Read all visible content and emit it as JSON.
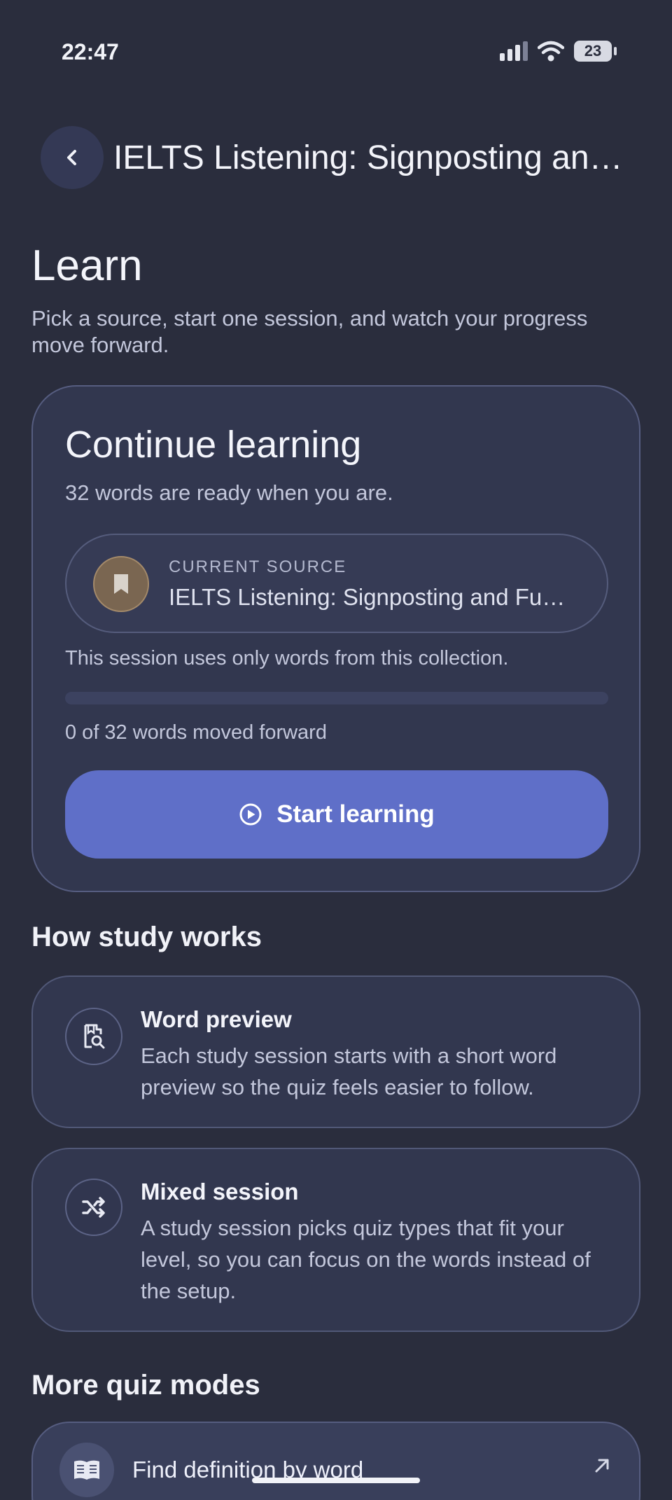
{
  "status": {
    "time": "22:47",
    "battery": "23"
  },
  "header": {
    "title": "IELTS Listening: Signposting an…"
  },
  "page": {
    "title": "Learn",
    "subtitle": "Pick a source, start one session, and watch your progress move forward."
  },
  "continue": {
    "title": "Continue learning",
    "subtitle": "32 words are ready when you are.",
    "source_label": "CURRENT SOURCE",
    "source_name": "IELTS Listening: Signposting and Fu…",
    "note": "This session uses only words from this collection.",
    "progress_fraction": 0,
    "progress_text": "0 of 32 words moved forward",
    "start_label": "Start learning"
  },
  "how": {
    "heading": "How study works",
    "items": [
      {
        "title": "Word preview",
        "body": "Each study session starts with a short word preview so the quiz feels easier to follow.",
        "icon": "document-search-icon"
      },
      {
        "title": "Mixed session",
        "body": "A study session picks quiz types that fit your level, so you can focus on the words instead of the setup.",
        "icon": "shuffle-icon"
      }
    ]
  },
  "modes": {
    "heading": "More quiz modes",
    "items": [
      {
        "label": "Find definition by word",
        "icon": "book-icon"
      }
    ]
  },
  "colors": {
    "accent": "#5f6fc8",
    "background": "#2a2d3d",
    "card": "#32374f"
  }
}
